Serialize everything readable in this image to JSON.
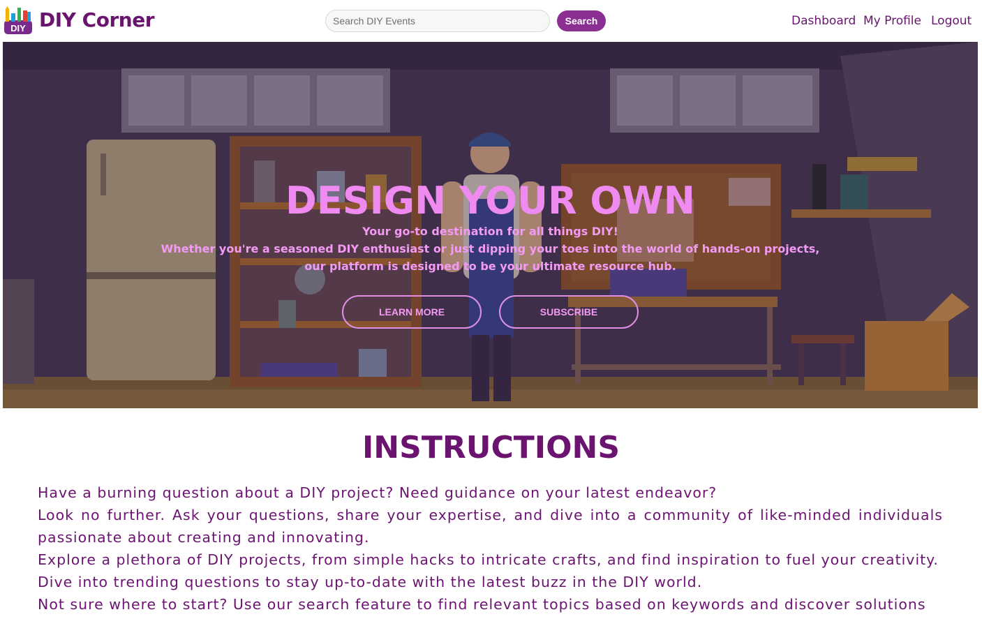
{
  "header": {
    "logo_text": "DIY",
    "brand": "DIY Corner",
    "search": {
      "placeholder": "Search DIY Events",
      "value": ""
    },
    "search_button": "Search",
    "nav": [
      {
        "label": "Dashboard"
      },
      {
        "label": "My Profile"
      },
      {
        "label": "Logout"
      }
    ]
  },
  "hero": {
    "title": "DESIGN YOUR OWN",
    "lines": [
      "Your go-to destination for all things DIY!",
      "Whether you're a seasoned DIY enthusiast or just dipping your toes into the world of hands-on projects,",
      "our platform is designed to be your ultimate resource hub."
    ],
    "buttons": [
      {
        "label": "LEARN MORE"
      },
      {
        "label": "SUBSCRIBE"
      }
    ]
  },
  "instructions": {
    "title": "INSTRUCTIONS",
    "paragraphs": [
      "Have a burning question about a DIY project? Need guidance on your latest endeavor?",
      "Look no further. Ask your questions, share your expertise, and dive into a community of like-minded individuals passionate about creating and innovating.",
      "Explore a plethora of DIY projects, from simple hacks to intricate crafts, and find inspiration to fuel your creativity.",
      "Dive into trending questions to stay up-to-date with the latest buzz in the DIY world.",
      "Not sure where to start? Use our search feature to find relevant topics based on keywords and discover solutions"
    ]
  },
  "colors": {
    "brand": "#6a1470",
    "button": "#8c2f92",
    "hero_text": "#f39af4"
  }
}
